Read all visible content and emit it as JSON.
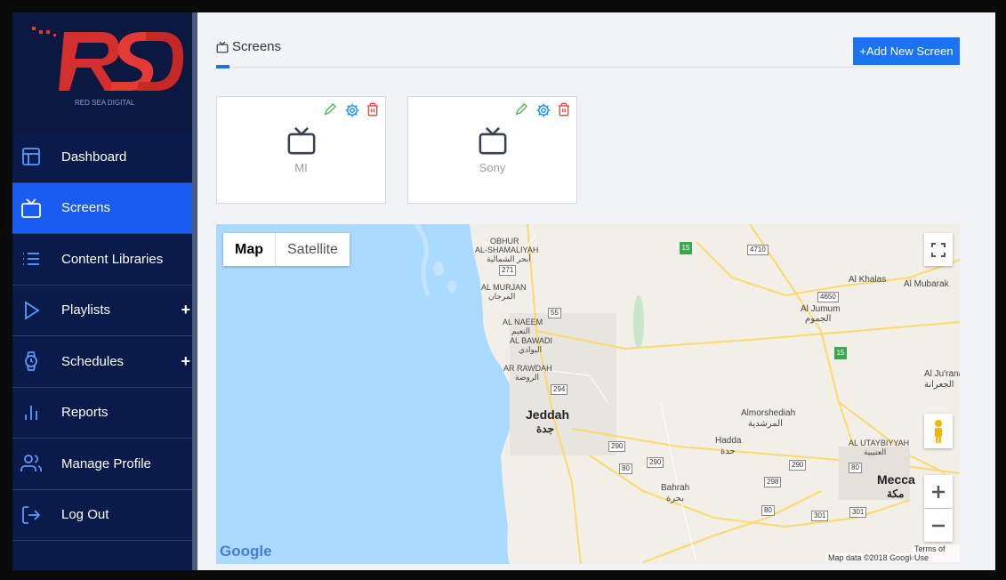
{
  "app": {
    "brand_letters": "RSD",
    "brand_name": "RED SEA DIGITAL"
  },
  "sidebar": {
    "items": [
      {
        "label": "Dashboard",
        "icon": "dashboard-icon",
        "active": false,
        "plus": ""
      },
      {
        "label": "Screens",
        "icon": "tv-icon",
        "active": true,
        "plus": ""
      },
      {
        "label": "Content Libraries",
        "icon": "list-icon",
        "active": false,
        "plus": ""
      },
      {
        "label": "Playlists",
        "icon": "play-icon",
        "active": false,
        "plus": "+"
      },
      {
        "label": "Schedules",
        "icon": "watch-icon",
        "active": false,
        "plus": "+"
      },
      {
        "label": "Reports",
        "icon": "bar-chart-icon",
        "active": false,
        "plus": ""
      },
      {
        "label": "Manage Profile",
        "icon": "users-icon",
        "active": false,
        "plus": ""
      },
      {
        "label": "Log Out",
        "icon": "logout-icon",
        "active": false,
        "plus": ""
      }
    ]
  },
  "page": {
    "title": "Screens",
    "add_button": "+Add New Screen"
  },
  "screens": [
    {
      "name": "MI"
    },
    {
      "name": "Sony"
    }
  ],
  "map": {
    "map_tab": "Map",
    "satellite_tab": "Satellite",
    "google": "Google",
    "data_credit": "Map data ©2018 Google",
    "terms": "Terms of Use",
    "labels": {
      "obhur": "OBHUR",
      "shamaliyah": "AL-SHAMALIYAH",
      "obhur_ar": "أبحر الشمالية",
      "murjan": "AL MURJAN",
      "murjan_ar": "المرجان",
      "naeem": "AL NAEEM",
      "naeem_ar": "النعيم",
      "bawadi": "AL BAWADI",
      "bawadi_ar": "البوادي",
      "rawdah": "AR RAWDAH",
      "rawdah_ar": "الروضة",
      "jeddah": "Jeddah",
      "jeddah_ar": "جدة",
      "khalas": "Al Khalas",
      "mubarak": "Al Mubarak",
      "jumum": "Al Jumum",
      "jumum_ar": "الجموم",
      "jurana": "Al Ju'rana",
      "jurana_ar": "الجعرانة",
      "morshediah": "Almorshediah",
      "morshediah_ar": "المرشدية",
      "hadda": "Hadda",
      "hadda_ar": "حدة",
      "utaybiyyah": "AL UTAYBIYYAH",
      "utaybiyyah_ar": "العتيبية",
      "mecca": "Mecca",
      "mecca_ar": "مكة",
      "bahrah": "Bahrah",
      "bahrah_ar": "بحرة"
    },
    "shields": {
      "s271": "271",
      "s55": "55",
      "s294": "294",
      "s290a": "290",
      "s80a": "80",
      "s290b": "290",
      "s298": "298",
      "s290c": "290",
      "s80b": "80",
      "s80c": "80",
      "s301a": "301",
      "s301b": "301",
      "s4710": "4710",
      "s4650": "4650",
      "g15a": "15",
      "g15b": "15"
    }
  }
}
